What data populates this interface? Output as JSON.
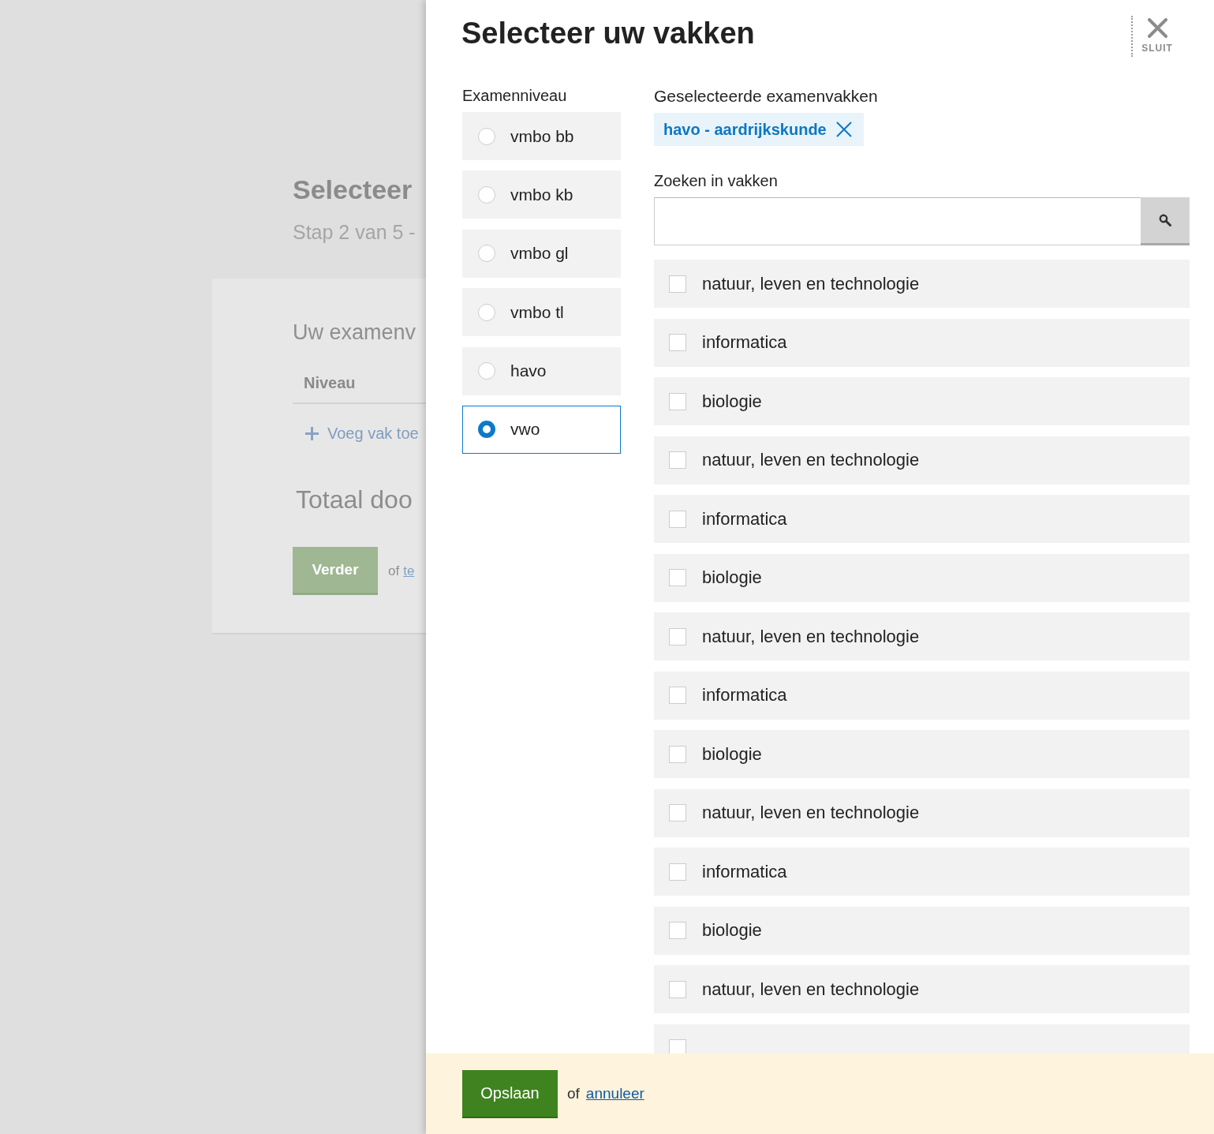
{
  "background_page": {
    "title": "Selecteer",
    "subtitle": "Stap 2 van 5 -",
    "card": {
      "heading": "Uw examenv",
      "column_header": "Niveau",
      "add_link": "Voeg vak toe",
      "total": "Totaal doo",
      "next_button": "Verder",
      "alt_text": "of",
      "alt_link": "te"
    }
  },
  "drawer": {
    "title": "Selecteer uw vakken",
    "close_label": "SLUIT",
    "level_label": "Examenniveau",
    "levels": [
      {
        "label": "vmbo bb",
        "selected": false
      },
      {
        "label": "vmbo kb",
        "selected": false
      },
      {
        "label": "vmbo gl",
        "selected": false
      },
      {
        "label": "vmbo tl",
        "selected": false
      },
      {
        "label": "havo",
        "selected": false
      },
      {
        "label": "vwo",
        "selected": true
      }
    ],
    "selected_label": "Geselecteerde examenvakken",
    "selected_tags": [
      {
        "label": "havo - aardrijkskunde"
      }
    ],
    "search": {
      "label": "Zoeken in vakken"
    },
    "subjects": [
      {
        "label": "natuur, leven en technologie",
        "checked": false
      },
      {
        "label": "informatica",
        "checked": false
      },
      {
        "label": "biologie",
        "checked": false
      },
      {
        "label": "natuur, leven en technologie",
        "checked": false
      },
      {
        "label": "informatica",
        "checked": false
      },
      {
        "label": "biologie",
        "checked": false
      },
      {
        "label": "natuur, leven en technologie",
        "checked": false
      },
      {
        "label": "informatica",
        "checked": false
      },
      {
        "label": "biologie",
        "checked": false
      },
      {
        "label": "natuur, leven en technologie",
        "checked": false
      },
      {
        "label": "informatica",
        "checked": false
      },
      {
        "label": "biologie",
        "checked": false
      },
      {
        "label": "natuur, leven en technologie",
        "checked": false
      },
      {
        "checked": false
      }
    ]
  },
  "footer": {
    "save_button": "Opslaan",
    "or_text": "of",
    "cancel_link": "annuleer"
  }
}
